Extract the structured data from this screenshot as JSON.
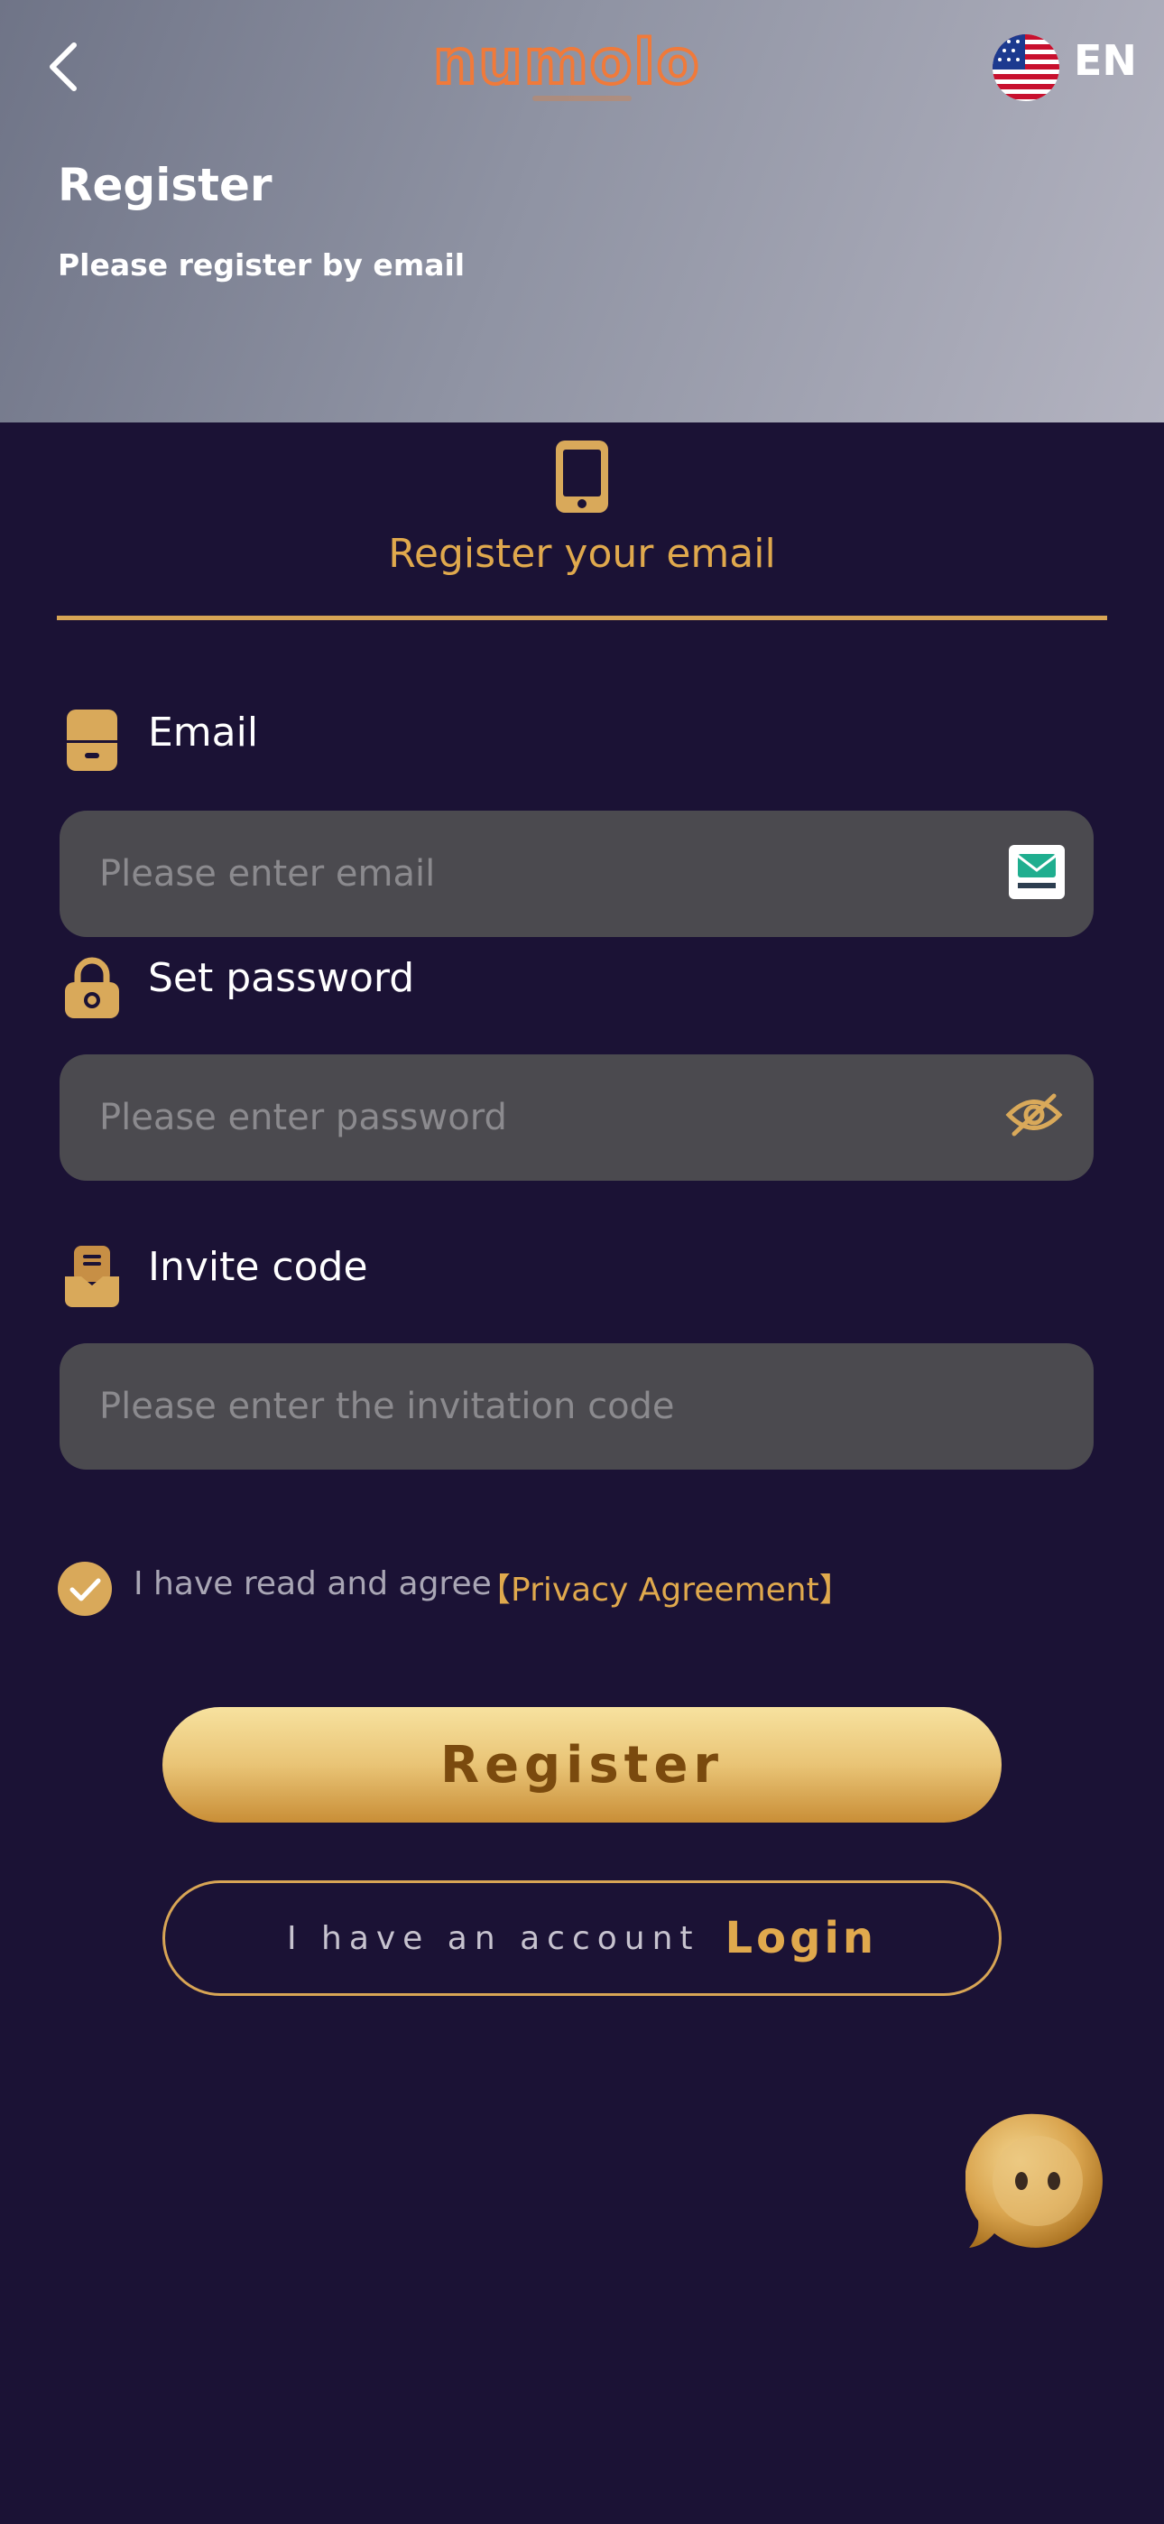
{
  "header": {
    "logo_text": "numolo",
    "language": "EN",
    "title": "Register",
    "subtitle": "Please register by email"
  },
  "tab": {
    "label": "Register your email"
  },
  "email": {
    "label": "Email",
    "placeholder": "Please enter email",
    "value": ""
  },
  "password": {
    "label": "Set password",
    "placeholder": "Please enter password",
    "value": ""
  },
  "invite": {
    "label": "Invite code",
    "placeholder": "Please enter the invitation code",
    "value": ""
  },
  "agreement": {
    "checked": true,
    "text": "I have read and agree",
    "link": "【Privacy Agreement】"
  },
  "buttons": {
    "register": "Register",
    "have_account": "I have an account",
    "login": "Login"
  },
  "icons": {
    "back": "back-chevron-icon",
    "flag": "us-flag-icon",
    "phone": "phone-icon",
    "email_field": "inbox-icon",
    "password_field": "lock-icon",
    "invite_field": "tray-icon",
    "tempmail": "tempmail-icon",
    "toggle_password": "eye-off-icon",
    "check": "check-icon",
    "support": "chat-bot-icon"
  },
  "colors": {
    "background": "#1b1235",
    "accent": "#e0a94d",
    "input_bg": "#4b4a4f",
    "logo": "#f07a3a"
  }
}
